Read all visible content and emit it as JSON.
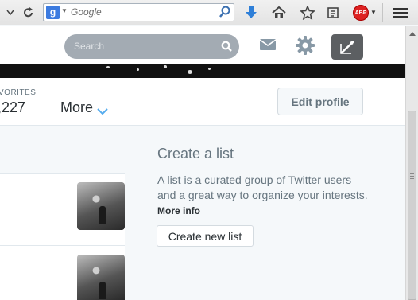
{
  "browser": {
    "search_placeholder": "Google",
    "search_engine_letter": "g",
    "addon_label": "ABP"
  },
  "twitter_nav": {
    "search_placeholder": "Search"
  },
  "profile_stats": {
    "favorites_label": "VORITES",
    "favorites_count": ",227",
    "more_label": "More",
    "edit_profile_label": "Edit profile"
  },
  "create_list": {
    "title": "Create a list",
    "description": "A list is a curated group of Twitter users and a great way to organize your interests.",
    "more_info_label": "More info",
    "create_button_label": "Create new list"
  },
  "colors": {
    "compose_bg": "#5c5f62",
    "search_bg": "#a3abb3",
    "abp_red": "#d22"
  }
}
